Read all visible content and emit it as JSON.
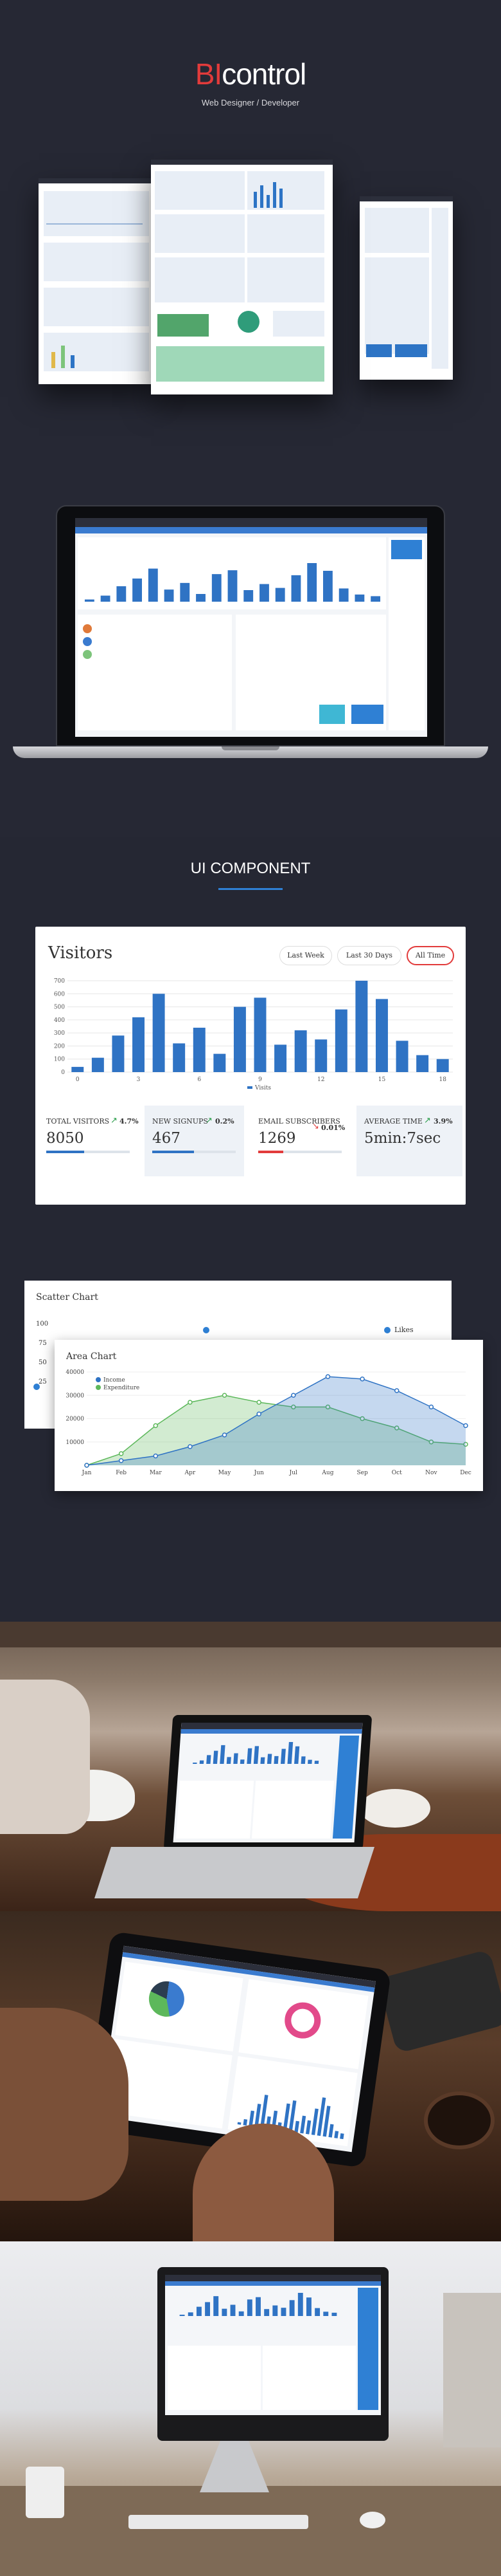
{
  "hero": {
    "brand_bi": "BI",
    "brand_rest": "control",
    "subtitle": "Web Designer / Developer"
  },
  "ui_component": {
    "title": "UI COMPONENT"
  },
  "visitors": {
    "title": "Visitors",
    "filters": [
      "Last Week",
      "Last 30 Days",
      "All Time"
    ],
    "active_filter": "All Time",
    "chart_data": {
      "type": "bar",
      "x": [
        1,
        2,
        3,
        4,
        5,
        6,
        7,
        8,
        9,
        10,
        11,
        12,
        13,
        14,
        15,
        16,
        17,
        18,
        19
      ],
      "values": [
        40,
        110,
        280,
        420,
        600,
        220,
        340,
        140,
        500,
        570,
        210,
        320,
        250,
        480,
        700,
        560,
        240,
        130,
        100
      ],
      "ylim": [
        0,
        700
      ],
      "yticks": [
        0,
        100,
        200,
        300,
        400,
        500,
        600,
        700
      ],
      "xticks": [
        0,
        3,
        6,
        9,
        12,
        15,
        18
      ],
      "legend": "Visits",
      "color": "#2f73c4"
    },
    "stats": [
      {
        "label": "TOTAL VISITORS",
        "pct": "4.7%",
        "value": "8050",
        "progress": 0.45,
        "color": "#2f73c4",
        "trend": "up"
      },
      {
        "label": "NEW SIGNUPS",
        "pct": "0.2%",
        "value": "467",
        "progress": 0.5,
        "color": "#2f73c4",
        "trend": "up"
      },
      {
        "label": "EMAIL SUBSCRIBERS",
        "pct": "0.01%",
        "value": "1269",
        "progress": 0.3,
        "color": "#e23b3b",
        "trend": "down"
      },
      {
        "label": "AVERAGE TIME",
        "pct": "3.9%",
        "value": "5min:7sec",
        "progress": 0,
        "color": "#2f73c4",
        "trend": "up"
      }
    ]
  },
  "scatter": {
    "title": "Scatter Chart",
    "yticks": [
      "100",
      "75",
      "50",
      "25"
    ],
    "legend": "Likes"
  },
  "area": {
    "title": "Area Chart",
    "chart_data": {
      "type": "area",
      "categories": [
        "Jan",
        "Feb",
        "Mar",
        "Apr",
        "May",
        "Jun",
        "Jul",
        "Aug",
        "Sep",
        "Oct",
        "Nov",
        "Dec"
      ],
      "ylim": [
        0,
        40000
      ],
      "yticks": [
        "40000",
        "30000",
        "20000",
        "10000"
      ],
      "series": [
        {
          "name": "Income",
          "values": [
            0,
            2000,
            4000,
            8000,
            13000,
            22000,
            30000,
            38000,
            37000,
            32000,
            25000,
            17000
          ],
          "color": "#2f73c4"
        },
        {
          "name": "Expenditure",
          "values": [
            0,
            5000,
            17000,
            27000,
            30000,
            27000,
            25000,
            25000,
            20000,
            16000,
            10000,
            9000
          ],
          "color": "#5db85b"
        }
      ]
    }
  }
}
